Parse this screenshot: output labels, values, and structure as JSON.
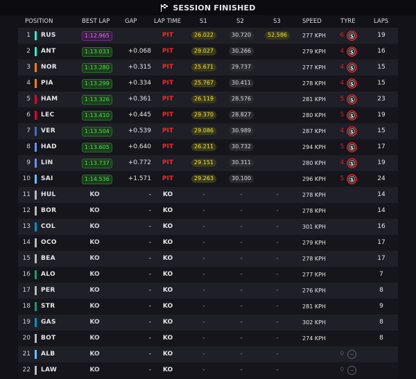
{
  "header": {
    "title": "SESSION FINISHED",
    "icon": "checkered-flag-icon"
  },
  "columns": [
    "POSITION",
    "BEST LAP",
    "GAP",
    "LAP TIME",
    "S1",
    "S2",
    "S3",
    "SPEED",
    "TYRE",
    "LAPS"
  ],
  "colors": {
    "pit": "#ff2424",
    "personal_best": "#4be04b",
    "session_best": "#d977ff",
    "sector_yellow": "#f2e44a",
    "tyre_soft": "#e8212b"
  },
  "rows": [
    {
      "pos": "1",
      "code": "RUS",
      "team_color": "#27f4d2",
      "best": "1:12.965",
      "best_style": "purple",
      "gap": "",
      "lap_time": "PIT",
      "s1": "26.022",
      "s2": "30.720",
      "s3": "52.586",
      "speed": "277 KPH",
      "tyre_count": "6",
      "tyre": "S",
      "laps": "19"
    },
    {
      "pos": "2",
      "code": "ANT",
      "team_color": "#27f4d2",
      "best": "1:13.033",
      "best_style": "green",
      "gap": "+0.068",
      "lap_time": "PIT",
      "s1": "29.027",
      "s2": "30.266",
      "s3": "",
      "speed": "279 KPH",
      "tyre_count": "4",
      "tyre": "S",
      "laps": "16"
    },
    {
      "pos": "3",
      "code": "NOR",
      "team_color": "#ff8000",
      "best": "1:13.280",
      "best_style": "green",
      "gap": "+0.315",
      "lap_time": "PIT",
      "s1": "25.671",
      "s2": "29.737",
      "s3": "",
      "speed": "277 KPH",
      "tyre_count": "4",
      "tyre": "S",
      "laps": "15"
    },
    {
      "pos": "4",
      "code": "PIA",
      "team_color": "#ff8000",
      "best": "1:13.299",
      "best_style": "green",
      "gap": "+0.334",
      "lap_time": "PIT",
      "s1": "25.767",
      "s2": "30.411",
      "s3": "",
      "speed": "278 KPH",
      "tyre_count": "4",
      "tyre": "S",
      "laps": "15"
    },
    {
      "pos": "5",
      "code": "HAM",
      "team_color": "#e8002d",
      "best": "1:13.326",
      "best_style": "green",
      "gap": "+0.361",
      "lap_time": "PIT",
      "s1": "26.119",
      "s2": "28.576",
      "s3": "",
      "speed": "281 KPH",
      "tyre_count": "5",
      "tyre": "S",
      "laps": "23"
    },
    {
      "pos": "6",
      "code": "LEC",
      "team_color": "#e8002d",
      "best": "1:13.410",
      "best_style": "green",
      "gap": "+0.445",
      "lap_time": "PIT",
      "s1": "29.370",
      "s2": "28.827",
      "s3": "",
      "speed": "280 KPH",
      "tyre_count": "5",
      "tyre": "S",
      "laps": "19"
    },
    {
      "pos": "7",
      "code": "VER",
      "team_color": "#3671c6",
      "best": "1:13.504",
      "best_style": "green",
      "gap": "+0.539",
      "lap_time": "PIT",
      "s1": "29.086",
      "s2": "30.989",
      "s3": "",
      "speed": "287 KPH",
      "tyre_count": "4",
      "tyre": "S",
      "laps": "15"
    },
    {
      "pos": "8",
      "code": "HAD",
      "team_color": "#6692ff",
      "best": "1:13.605",
      "best_style": "green",
      "gap": "+0.640",
      "lap_time": "PIT",
      "s1": "26.211",
      "s2": "30.732",
      "s3": "",
      "speed": "294 KPH",
      "tyre_count": "5",
      "tyre": "S",
      "laps": "17"
    },
    {
      "pos": "9",
      "code": "LIN",
      "team_color": "#6692ff",
      "best": "1:13.737",
      "best_style": "green",
      "gap": "+0.772",
      "lap_time": "PIT",
      "s1": "29.151",
      "s2": "30.311",
      "s3": "",
      "speed": "280 KPH",
      "tyre_count": "4",
      "tyre": "S",
      "laps": "19"
    },
    {
      "pos": "10",
      "code": "SAI",
      "team_color": "#64c4ff",
      "best": "1:14.536",
      "best_style": "green",
      "gap": "+1.571",
      "lap_time": "PIT",
      "s1": "29.263",
      "s2": "30.100",
      "s3": "",
      "speed": "296 KPH",
      "tyre_count": "5",
      "tyre": "S",
      "laps": "24"
    },
    {
      "pos": "11",
      "code": "HUL",
      "team_color": "#b6babd",
      "best": "KO",
      "best_style": "ko",
      "gap": "-",
      "lap_time": "KO",
      "s1": "-",
      "s2": "-",
      "s3": "-",
      "speed": "278 KPH",
      "tyre_count": "",
      "tyre": "",
      "laps": "14"
    },
    {
      "pos": "12",
      "code": "BOR",
      "team_color": "#b6babd",
      "best": "KO",
      "best_style": "ko",
      "gap": "-",
      "lap_time": "KO",
      "s1": "-",
      "s2": "-",
      "s3": "-",
      "speed": "278 KPH",
      "tyre_count": "",
      "tyre": "",
      "laps": "14"
    },
    {
      "pos": "13",
      "code": "COL",
      "team_color": "#0093cc",
      "best": "KO",
      "best_style": "ko",
      "gap": "-",
      "lap_time": "KO",
      "s1": "-",
      "s2": "-",
      "s3": "-",
      "speed": "301 KPH",
      "tyre_count": "",
      "tyre": "",
      "laps": "16"
    },
    {
      "pos": "14",
      "code": "OCO",
      "team_color": "#b6babd",
      "best": "KO",
      "best_style": "ko",
      "gap": "-",
      "lap_time": "KO",
      "s1": "-",
      "s2": "-",
      "s3": "-",
      "speed": "279 KPH",
      "tyre_count": "",
      "tyre": "",
      "laps": "17"
    },
    {
      "pos": "15",
      "code": "BEA",
      "team_color": "#b6babd",
      "best": "KO",
      "best_style": "ko",
      "gap": "-",
      "lap_time": "KO",
      "s1": "-",
      "s2": "-",
      "s3": "-",
      "speed": "278 KPH",
      "tyre_count": "",
      "tyre": "",
      "laps": "17"
    },
    {
      "pos": "16",
      "code": "ALO",
      "team_color": "#229971",
      "best": "KO",
      "best_style": "ko",
      "gap": "-",
      "lap_time": "KO",
      "s1": "-",
      "s2": "-",
      "s3": "-",
      "speed": "277 KPH",
      "tyre_count": "",
      "tyre": "",
      "laps": "7"
    },
    {
      "pos": "17",
      "code": "PER",
      "team_color": "#b6babd",
      "best": "KO",
      "best_style": "ko",
      "gap": "-",
      "lap_time": "KO",
      "s1": "-",
      "s2": "-",
      "s3": "-",
      "speed": "276 KPH",
      "tyre_count": "",
      "tyre": "",
      "laps": "8"
    },
    {
      "pos": "18",
      "code": "STR",
      "team_color": "#229971",
      "best": "KO",
      "best_style": "ko",
      "gap": "-",
      "lap_time": "KO",
      "s1": "-",
      "s2": "-",
      "s3": "-",
      "speed": "281 KPH",
      "tyre_count": "",
      "tyre": "",
      "laps": "9"
    },
    {
      "pos": "19",
      "code": "GAS",
      "team_color": "#0093cc",
      "best": "KO",
      "best_style": "ko",
      "gap": "-",
      "lap_time": "KO",
      "s1": "-",
      "s2": "-",
      "s3": "-",
      "speed": "302 KPH",
      "tyre_count": "",
      "tyre": "",
      "laps": "8"
    },
    {
      "pos": "20",
      "code": "BOT",
      "team_color": "#b6babd",
      "best": "KO",
      "best_style": "ko",
      "gap": "-",
      "lap_time": "KO",
      "s1": "-",
      "s2": "-",
      "s3": "-",
      "speed": "274 KPH",
      "tyre_count": "",
      "tyre": "",
      "laps": "8"
    },
    {
      "pos": "21",
      "code": "ALB",
      "team_color": "#64c4ff",
      "best": "KO",
      "best_style": "ko",
      "gap": "-",
      "lap_time": "KO",
      "s1": "-",
      "s2": "-",
      "s3": "-",
      "speed": "",
      "tyre_count": "0",
      "tyre": "dim",
      "laps": ""
    },
    {
      "pos": "22",
      "code": "LAW",
      "team_color": "#b6babd",
      "best": "KO",
      "best_style": "ko",
      "gap": "-",
      "lap_time": "KO",
      "s1": "-",
      "s2": "-",
      "s3": "-",
      "speed": "",
      "tyre_count": "0",
      "tyre": "dim",
      "laps": ""
    }
  ]
}
